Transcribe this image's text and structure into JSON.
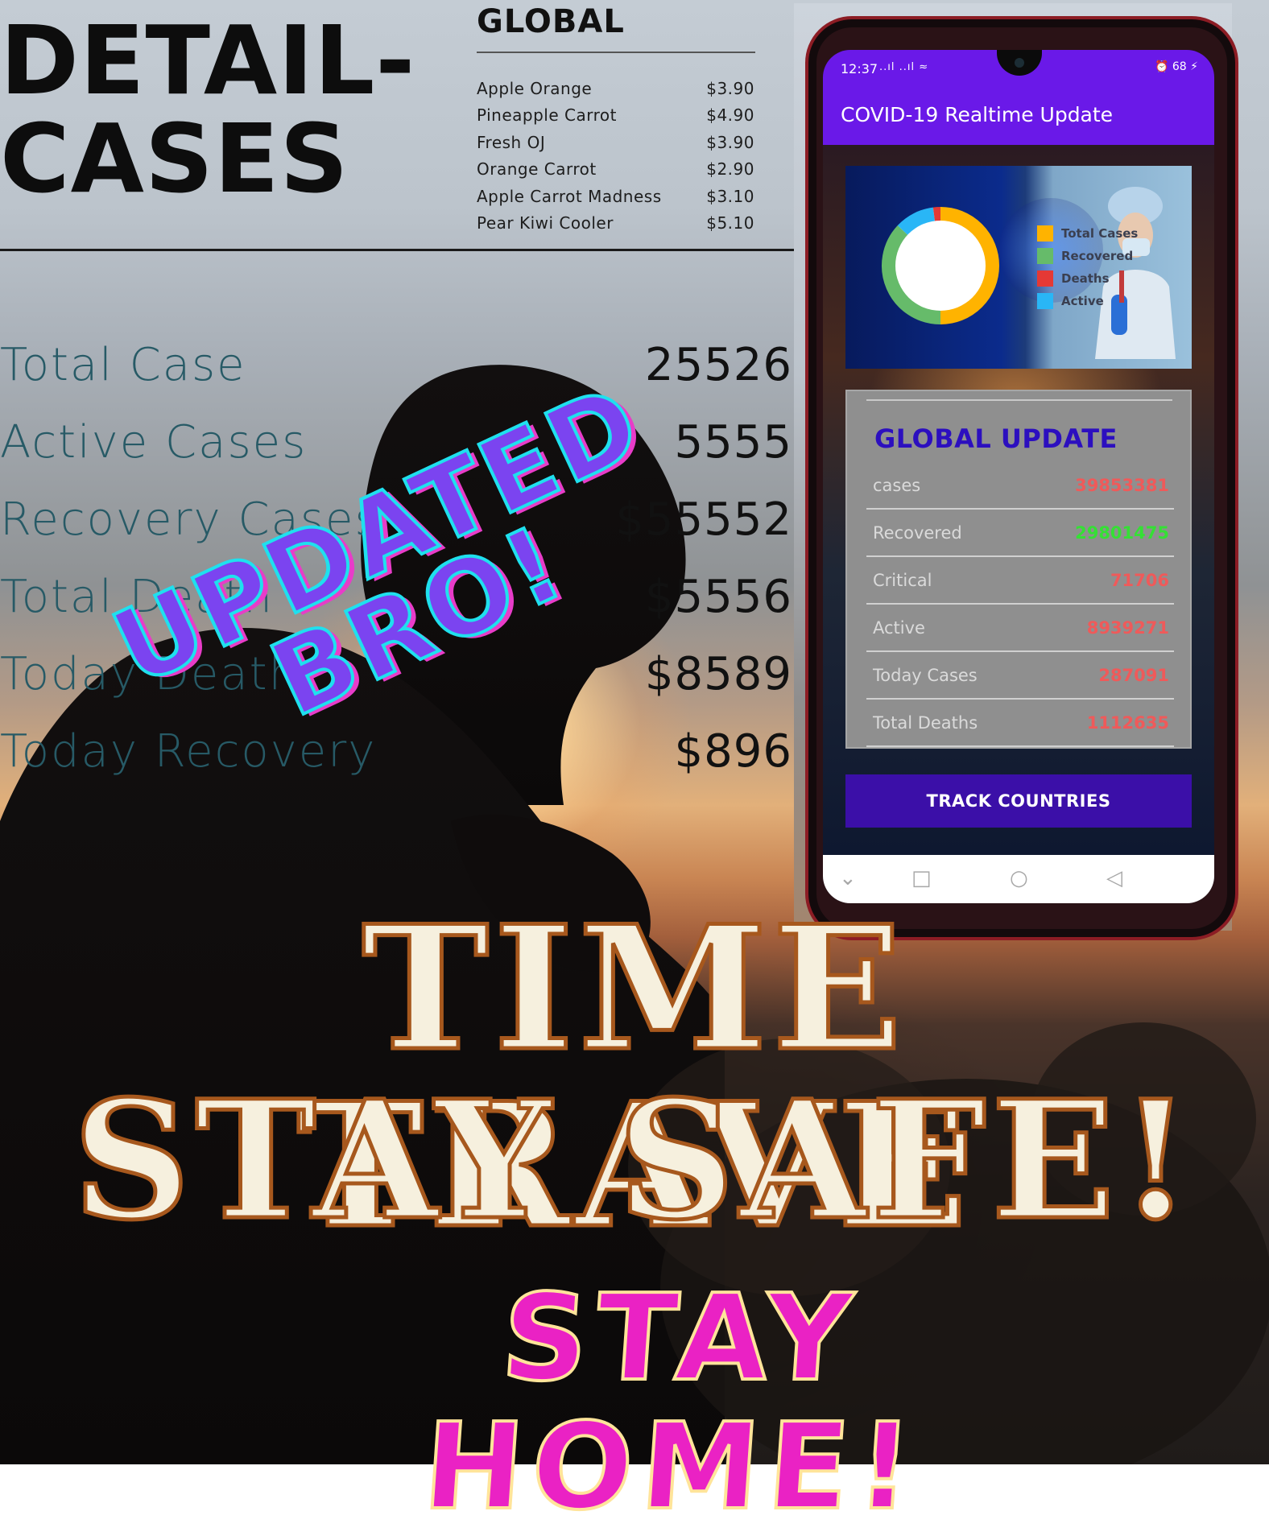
{
  "poster": {
    "title": "DETAIL-\nCASES",
    "menu": {
      "heading": "GLOBAL",
      "items": [
        {
          "name": "Apple Orange",
          "price": "$3.90"
        },
        {
          "name": "Pineapple Carrot",
          "price": "$4.90"
        },
        {
          "name": "Fresh OJ",
          "price": "$3.90"
        },
        {
          "name": "Orange Carrot",
          "price": "$2.90"
        },
        {
          "name": "Apple Carrot Madness",
          "price": "$3.10"
        },
        {
          "name": "Pear Kiwi Cooler",
          "price": "$5.10"
        }
      ]
    },
    "stats": [
      {
        "label": "Total Case",
        "value": "25526"
      },
      {
        "label": "Active Cases",
        "value": "5555"
      },
      {
        "label": "Recovery Cases",
        "value": "$55552"
      },
      {
        "label": "Total Death",
        "value": "$5556"
      },
      {
        "label": "Today Death",
        "value": "$8589"
      },
      {
        "label": "Today Recovery",
        "value": "$896"
      }
    ],
    "stamp": {
      "line1": "UPDATED",
      "line2": "BRO!"
    },
    "headline1": "TIME TRAVE",
    "headline2": "STAY SAFE!",
    "tagline": "STAY HOME!"
  },
  "phone": {
    "status_time": "12:37",
    "status_signal": "..ıl ..ıl ≈",
    "status_right": "⏰ 68 ⚡",
    "app_title": "COVID-19 Realtime Update",
    "donut_colors": {
      "total": "#ffb300",
      "recovered": "#66bb6a",
      "deaths": "#e53935",
      "active": "#29b6f6"
    },
    "legend": [
      "Total Cases",
      "Recovered",
      "Deaths",
      "Active"
    ],
    "card_title": "GLOBAL UPDATE",
    "rows": [
      {
        "label": "cases",
        "value": "39853381"
      },
      {
        "label": "Recovered",
        "value": "29801475"
      },
      {
        "label": "Critical",
        "value": "71706"
      },
      {
        "label": "Active",
        "value": "8939271"
      },
      {
        "label": "Today Cases",
        "value": "287091"
      },
      {
        "label": "Total Deaths",
        "value": "1112635"
      }
    ],
    "track_button": "TRACK COUNTRIES",
    "nav": {
      "back": "◁",
      "home": "○",
      "recents": "□",
      "down": "⌄"
    }
  }
}
